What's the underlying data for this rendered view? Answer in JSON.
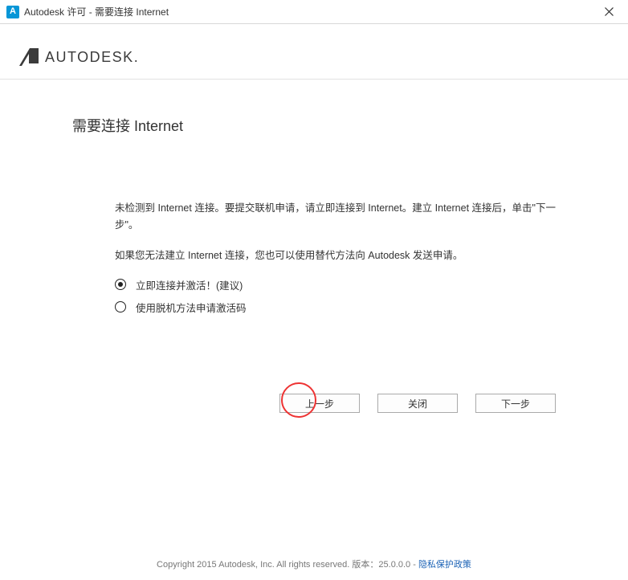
{
  "window": {
    "title": "Autodesk 许可 - 需要连接 Internet"
  },
  "brand": {
    "name": "AUTODESK."
  },
  "page": {
    "heading": "需要连接 Internet",
    "para1": "未检测到 Internet 连接。要提交联机申请，请立即连接到 Internet。建立 Internet 连接后，单击\"下一步\"。",
    "para2": "如果您无法建立 Internet 连接，您也可以使用替代方法向 Autodesk 发送申请。"
  },
  "options": {
    "connect_now": "立即连接并激活！(建议)",
    "offline": "使用脱机方法申请激活码"
  },
  "buttons": {
    "back": "上一步",
    "close": "关闭",
    "next": "下一步"
  },
  "footer": {
    "copyright": "Copyright 2015 Autodesk, Inc. All rights reserved. 版本：25.0.0.0 - ",
    "privacy_link": "隐私保护政策"
  }
}
